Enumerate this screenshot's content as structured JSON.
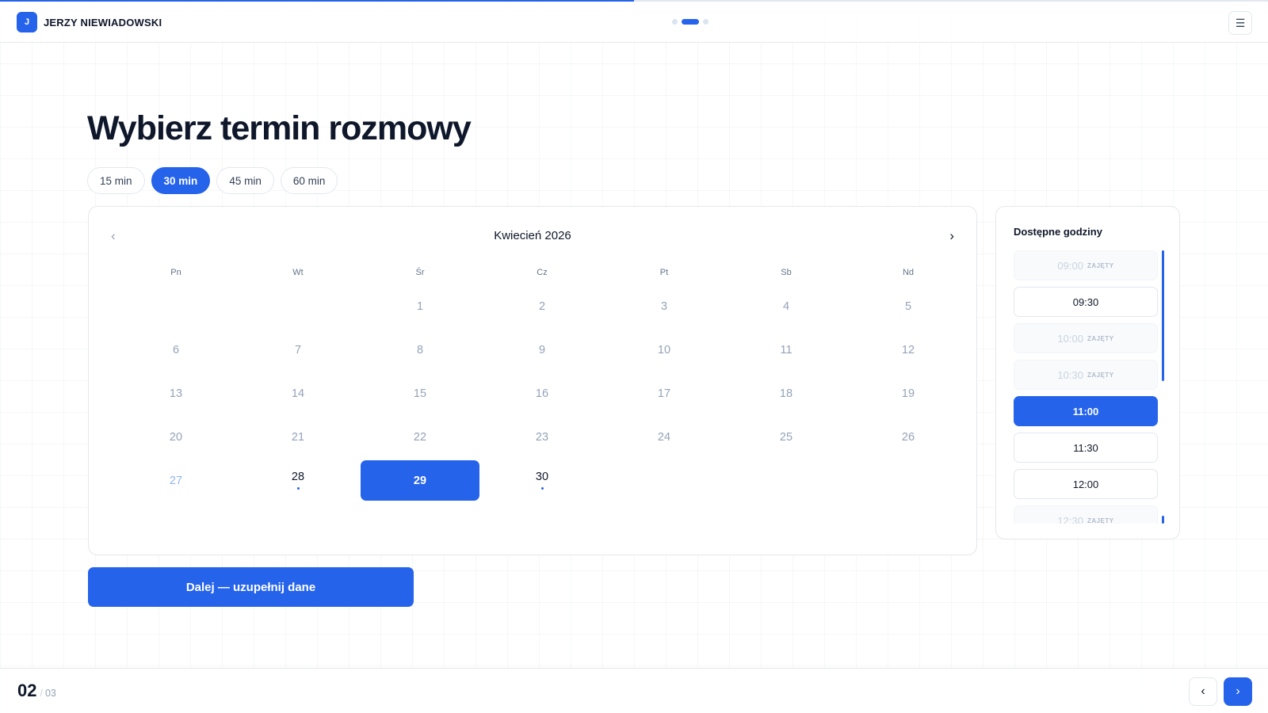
{
  "progress": {
    "value": 0.5
  },
  "header": {
    "brand_initial": "J",
    "brand_name": "JERZY NIEWIADOWSKI",
    "steps_total": 3,
    "step_active": 2,
    "menu_icon": "hamburger-icon"
  },
  "main": {
    "title": "Wybierz termin rozmowy",
    "durations": [
      {
        "label": "15 min",
        "selected": false
      },
      {
        "label": "30 min",
        "selected": true
      },
      {
        "label": "45 min",
        "selected": false
      },
      {
        "label": "60 min",
        "selected": false
      }
    ]
  },
  "calendar": {
    "month_label": "Kwiecień 2026",
    "prev_icon": "chevron-left-icon",
    "next_icon": "chevron-right-icon",
    "weekdays": [
      "Pn",
      "Wt",
      "Śr",
      "Cz",
      "Pt",
      "Sb",
      "Nd"
    ],
    "leading_blanks": 2,
    "days": [
      {
        "num": "1"
      },
      {
        "num": "2"
      },
      {
        "num": "3"
      },
      {
        "num": "4"
      },
      {
        "num": "5"
      },
      {
        "num": "6"
      },
      {
        "num": "7"
      },
      {
        "num": "8"
      },
      {
        "num": "9"
      },
      {
        "num": "10"
      },
      {
        "num": "11"
      },
      {
        "num": "12"
      },
      {
        "num": "13"
      },
      {
        "num": "14"
      },
      {
        "num": "15"
      },
      {
        "num": "16"
      },
      {
        "num": "17"
      },
      {
        "num": "18"
      },
      {
        "num": "19"
      },
      {
        "num": "20"
      },
      {
        "num": "21"
      },
      {
        "num": "22"
      },
      {
        "num": "23"
      },
      {
        "num": "24"
      },
      {
        "num": "25"
      },
      {
        "num": "26"
      },
      {
        "num": "27",
        "state": "today"
      },
      {
        "num": "28",
        "state": "available"
      },
      {
        "num": "29",
        "state": "selected"
      },
      {
        "num": "30",
        "state": "available"
      }
    ]
  },
  "slots": {
    "title": "Dostępne godziny",
    "busy_label": "ZAJĘTY",
    "items": [
      {
        "time": "09:00",
        "state": "busy"
      },
      {
        "time": "09:30",
        "state": "free"
      },
      {
        "time": "10:00",
        "state": "busy"
      },
      {
        "time": "10:30",
        "state": "busy"
      },
      {
        "time": "11:00",
        "state": "selected"
      },
      {
        "time": "11:30",
        "state": "free"
      },
      {
        "time": "12:00",
        "state": "free"
      },
      {
        "time": "12:30",
        "state": "busy"
      }
    ]
  },
  "cta": {
    "label": "Dalej — uzupełnij dane"
  },
  "footer": {
    "step_current": "02",
    "step_separator": "/",
    "step_total": "03",
    "prev_icon": "chevron-left-icon",
    "next_icon": "chevron-right-icon"
  },
  "colors": {
    "accent": "#2563eb",
    "text": "#0f172a",
    "muted": "#94a3b8"
  }
}
